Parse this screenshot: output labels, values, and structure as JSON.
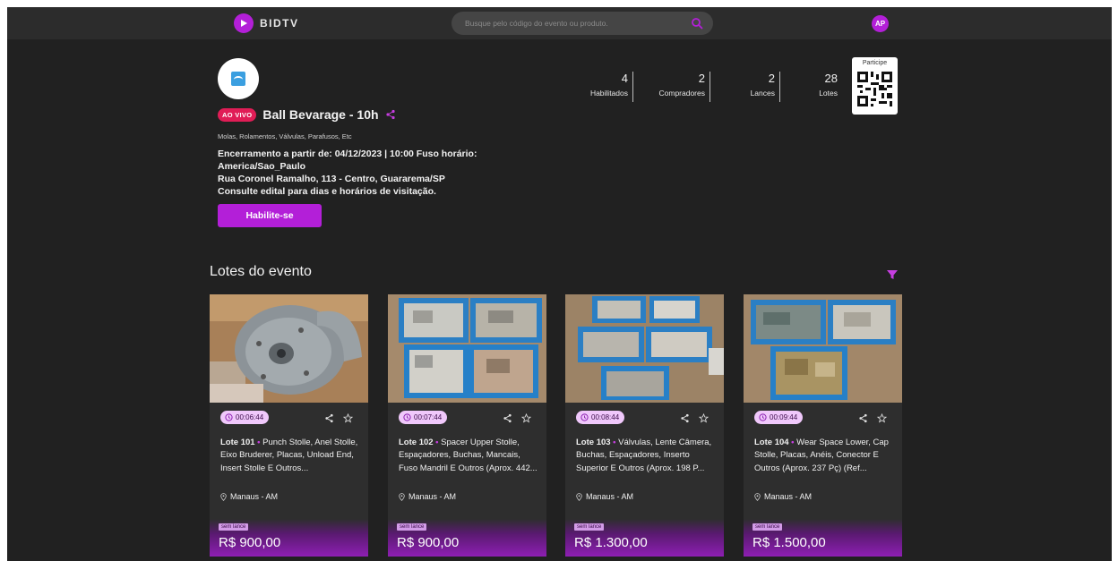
{
  "app": {
    "brand": "BIDTV",
    "search_placeholder": "Busque pelo código do evento ou produto.",
    "avatar_initials": "AP",
    "accent_color": "#b31fd8"
  },
  "event": {
    "live_badge": "AO VIVO",
    "title": "Ball Bevarage - 10h",
    "categories": "Molas, Rolamentos, Válvulas, Parafusos, Etc",
    "info_lines": [
      "Encerramento a partir de: 04/12/2023 | 10:00 Fuso horário:",
      "America/Sao_Paulo",
      "Rua Coronel Ramalho, 113 - Centro, Guararema/SP",
      "Consulte edital para dias e horários de visitação."
    ],
    "cta_label": "Habilite-se"
  },
  "stats": [
    {
      "value": "4",
      "label": "Habilitados"
    },
    {
      "value": "2",
      "label": "Compradores"
    },
    {
      "value": "2",
      "label": "Lances"
    },
    {
      "value": "28",
      "label": "Lotes"
    }
  ],
  "qr": {
    "label": "Participe"
  },
  "lots_section": {
    "title": "Lotes do evento"
  },
  "lots": [
    {
      "timer": "00:06:44",
      "code": "Lote 101",
      "desc": "Punch Stolle, Anel Stolle, Eixo Bruderer, Placas, Unload End, Insert Stolle E Outros...",
      "location": "Manaus - AM",
      "status": "sem lance",
      "price": "R$ 900,00"
    },
    {
      "timer": "00:07:44",
      "code": "Lote 102",
      "desc": "Spacer Upper Stolle, Espaçadores, Buchas, Mancais, Fuso Mandril E Outros (Aprox. 442...",
      "location": "Manaus - AM",
      "status": "sem lance",
      "price": "R$ 900,00"
    },
    {
      "timer": "00:08:44",
      "code": "Lote 103",
      "desc": "Válvulas, Lente Câmera, Buchas, Espaçadores, Inserto Superior E Outros (Aprox. 198 P...",
      "location": "Manaus - AM",
      "status": "sem lance",
      "price": "R$ 1.300,00"
    },
    {
      "timer": "00:09:44",
      "code": "Lote 104",
      "desc": "Wear Space Lower, Cap Stolle, Placas, Anéis, Conector E Outros (Aprox. 237 Pç) (Ref...",
      "location": "Manaus - AM",
      "status": "sem lance",
      "price": "R$ 1.500,00"
    }
  ]
}
